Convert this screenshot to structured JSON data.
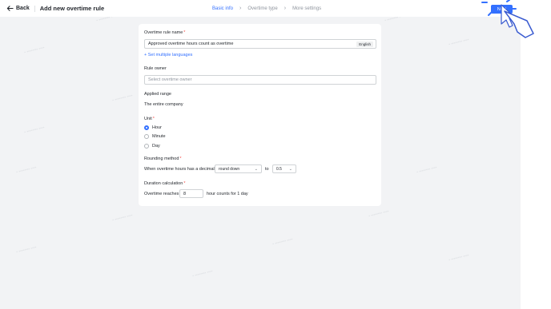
{
  "header": {
    "back_label": "Back",
    "title": "Add new overtime rule",
    "next_label": "Next"
  },
  "steps": [
    {
      "label": "Basic info",
      "active": true
    },
    {
      "label": "Overtime type",
      "active": false
    },
    {
      "label": "More settings",
      "active": false
    }
  ],
  "form": {
    "rule_name": {
      "label": "Overtime rule name",
      "value": "Approved overtime hours count as overtime",
      "language_tag": "English",
      "multi_lang_link": "Set multiple languages"
    },
    "rule_owner": {
      "label": "Rule owner",
      "placeholder": "Select overtime owner"
    },
    "applied_range": {
      "label": "Applied range",
      "value": "The entire company"
    },
    "unit": {
      "label": "Unit",
      "options": [
        "Hour",
        "Minute",
        "Day"
      ],
      "selected": "Hour"
    },
    "rounding": {
      "label": "Rounding method",
      "prefix": "When overtime hours has a decimal",
      "method": "round down",
      "connector": "to",
      "step": "0.5"
    },
    "duration": {
      "label": "Duration calculation",
      "prefix": "Overtime reaches",
      "value": "8",
      "suffix": "hour counts for 1 day"
    }
  },
  "colors": {
    "accent": "#3370ff",
    "required": "#f54a45",
    "canvas": "#f2f3f5"
  }
}
